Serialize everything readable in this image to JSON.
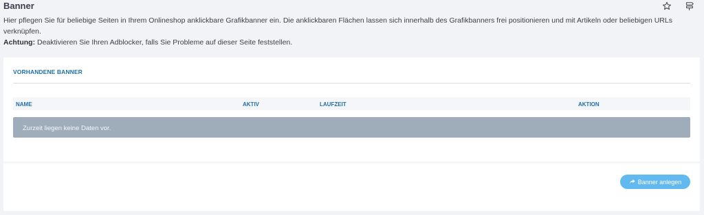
{
  "page": {
    "title": "Banner",
    "description": "Hier pflegen Sie für beliebige Seiten in Ihrem Onlineshop anklickbare Grafikbanner ein. Die anklickbaren Flächen lassen sich innerhalb des Grafikbanners frei positionieren und mit Artikeln oder beliebigen URLs verknüpfen.",
    "warning_label": "Achtung:",
    "warning_text": " Deaktivieren Sie Ihren Adblocker, falls Sie Probleme auf dieser Seite feststellen."
  },
  "top_icons": [
    "star-icon",
    "signpost-icon"
  ],
  "banner_section": {
    "title": "VORHANDENE BANNER",
    "columns": [
      "NAME",
      "AKTIV",
      "LAUFZEIT",
      "AKTION"
    ],
    "empty_message": "Zurzeit liegen keine Daten vor."
  },
  "actions": {
    "create_label": "Banner anlegen",
    "create_icon": "share-arrow-icon"
  },
  "colors": {
    "accent": "#1f6fa8",
    "button": "#62b9ef",
    "empty_row": "#9eadb9",
    "background": "#f1f3f7"
  }
}
